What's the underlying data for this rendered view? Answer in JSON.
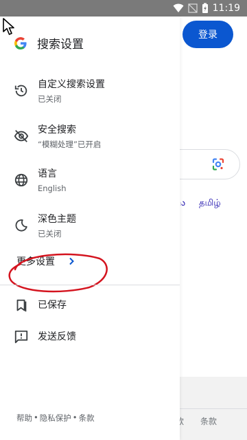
{
  "status_bar": {
    "time": "11:19"
  },
  "background": {
    "login_button": "登录",
    "lang_partial": "ు",
    "lang_tamil": "தமிழ்",
    "footer_partial": "款",
    "footer_terms": "条款"
  },
  "drawer": {
    "title": "搜索设置",
    "items": [
      {
        "label": "自定义搜索设置",
        "sub": "已关闭",
        "icon": "history-icon"
      },
      {
        "label": "安全搜索",
        "sub": "“模糊处理”已开启",
        "icon": "visibility-off-icon"
      },
      {
        "label": "语言",
        "sub": "English",
        "icon": "globe-icon"
      },
      {
        "label": "深色主题",
        "sub": "已关闭",
        "icon": "moon-icon"
      }
    ],
    "more_settings": "更多设置",
    "saved": "已保存",
    "feedback": "发送反馈",
    "footer": {
      "help": "帮助",
      "sep1": "•",
      "privacy": "隐私保护",
      "sep2": "•",
      "terms": "条款"
    }
  },
  "colors": {
    "accent": "#0b57d0",
    "annotation": "#d4141f",
    "status_bar": "#7a7a7a"
  }
}
